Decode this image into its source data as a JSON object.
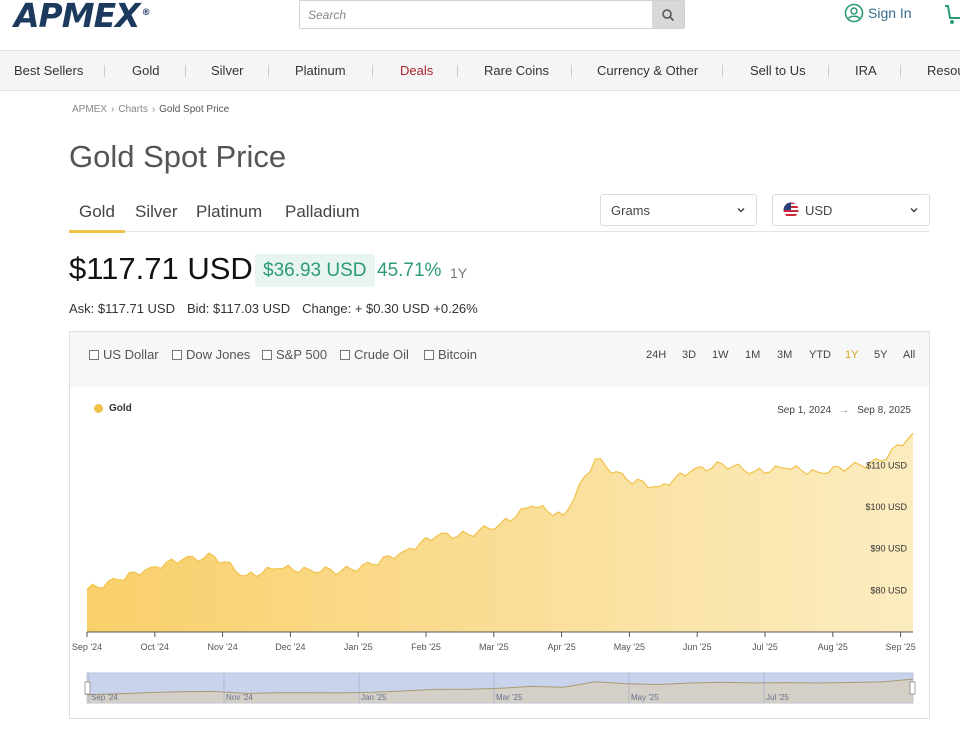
{
  "header": {
    "logo_text": "APMEX",
    "logo_reg": "®",
    "search_placeholder": "Search",
    "signin_label": "Sign In"
  },
  "nav": {
    "items": [
      "Best Sellers",
      "Gold",
      "Silver",
      "Platinum",
      "Deals",
      "Rare Coins",
      "Currency & Other",
      "Sell to Us",
      "IRA",
      "Resou"
    ]
  },
  "breadcrumb": [
    "APMEX",
    "Charts",
    "Gold Spot Price"
  ],
  "breadcrumb_sep": "›",
  "page_title": "Gold Spot Price",
  "metal_tabs": [
    "Gold",
    "Silver",
    "Platinum",
    "Palladium"
  ],
  "unit_select": "Grams",
  "currency_select": "USD",
  "price": {
    "value": "$117.71 USD",
    "change": "$36.93 USD",
    "change_pct": "45.71%",
    "period": "1Y",
    "ask": "Ask: $117.71 USD",
    "bid": "Bid: $117.03 USD",
    "day_change": "Change: + $0.30 USD +0.26%"
  },
  "compare_options": [
    "US Dollar",
    "Dow Jones",
    "S&P 500",
    "Crude Oil",
    "Bitcoin"
  ],
  "ranges": [
    "24H",
    "3D",
    "1W",
    "1M",
    "3M",
    "YTD",
    "1Y",
    "5Y",
    "All"
  ],
  "active_range": "1Y",
  "colors": {
    "accent": "#f1c24a",
    "positive": "#2b9b78",
    "deals": "#a8242a"
  },
  "chart_data": {
    "type": "area",
    "series": [
      {
        "name": "Gold",
        "x": [
          "Sep 1, 2024",
          "Sep 15",
          "Oct 1",
          "Oct 15",
          "Nov 1",
          "Nov 15",
          "Dec 1",
          "Dec 15",
          "Jan 1",
          "Jan 15",
          "Feb 1",
          "Feb 15",
          "Mar 1",
          "Mar 15",
          "Apr 1",
          "Apr 10",
          "Apr 22",
          "May 1",
          "May 15",
          "Jun 1",
          "Jun 15",
          "Jul 1",
          "Jul 15",
          "Aug 1",
          "Aug 15",
          "Sep 1",
          "Sep 8, 2025"
        ],
        "values": [
          80.2,
          82.5,
          85.5,
          87.3,
          88.2,
          83.5,
          85.2,
          85.0,
          84.6,
          86.2,
          89.5,
          93.0,
          93.4,
          95.9,
          100.2,
          98.0,
          111.5,
          106.5,
          104.9,
          108.5,
          110.3,
          108.5,
          109.3,
          108.4,
          109.6,
          111.0,
          117.71
        ]
      }
    ],
    "x_ticks": [
      "Sep '24",
      "Oct '24",
      "Nov '24",
      "Dec '24",
      "Jan '25",
      "Feb '25",
      "Mar '25",
      "Apr '25",
      "May '25",
      "Jun '25",
      "Jul '25",
      "Aug '25",
      "Sep '25"
    ],
    "y_ticks": [
      "$80 USD",
      "$90 USD",
      "$100 USD",
      "$110 USD"
    ],
    "y_tick_values": [
      80,
      90,
      100,
      110
    ],
    "ylim": [
      70,
      118
    ],
    "navigator_ticks": [
      "Sep '24",
      "Nov '24",
      "Jan '25",
      "Mar '25",
      "May '25",
      "Jul '25"
    ],
    "legend": "Gold",
    "date_from": "Sep 1, 2024",
    "date_arrow": "→",
    "date_to": "Sep 8, 2025"
  }
}
